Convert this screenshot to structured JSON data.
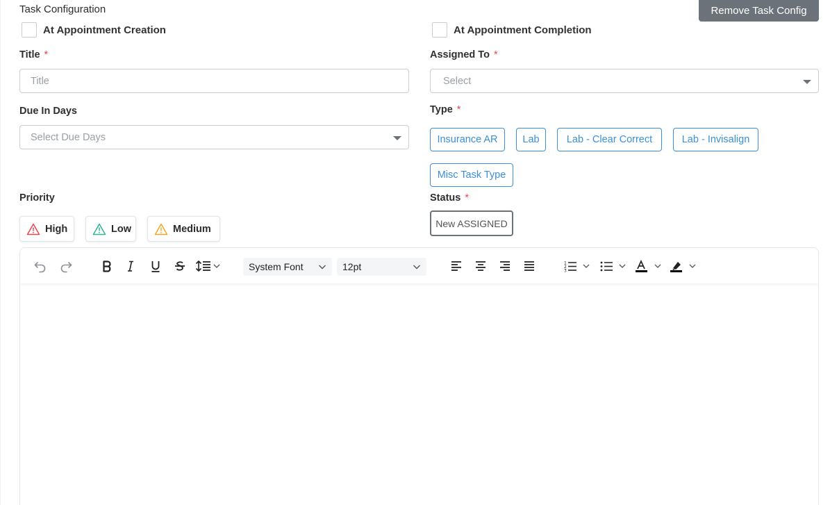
{
  "header": {
    "section_title": "Task Configuration",
    "remove_button": "Remove Task Config"
  },
  "triggers": {
    "creation_label": "At Appointment Creation",
    "completion_label": "At Appointment Completion"
  },
  "fields": {
    "title_label": "Title",
    "title_placeholder": "Title",
    "assigned_label": "Assigned To",
    "assigned_placeholder": "Select",
    "due_label": "Due In Days",
    "due_placeholder": "Select Due Days",
    "type_label": "Type",
    "priority_label": "Priority",
    "status_label": "Status",
    "required_mark": "*"
  },
  "types": [
    "Insurance AR",
    "Lab",
    "Lab - Clear Correct",
    "Lab - Invisalign",
    "Misc Task Type"
  ],
  "priorities": [
    {
      "label": "High",
      "color": "#e5484d"
    },
    {
      "label": "Low",
      "color": "#2bb59a"
    },
    {
      "label": "Medium",
      "color": "#f5a623"
    }
  ],
  "status": {
    "value": "New ASSIGNED"
  },
  "editor": {
    "font_family": "System Font",
    "font_size": "12pt",
    "text_color": "#000000",
    "highlight_color": "#000000"
  }
}
